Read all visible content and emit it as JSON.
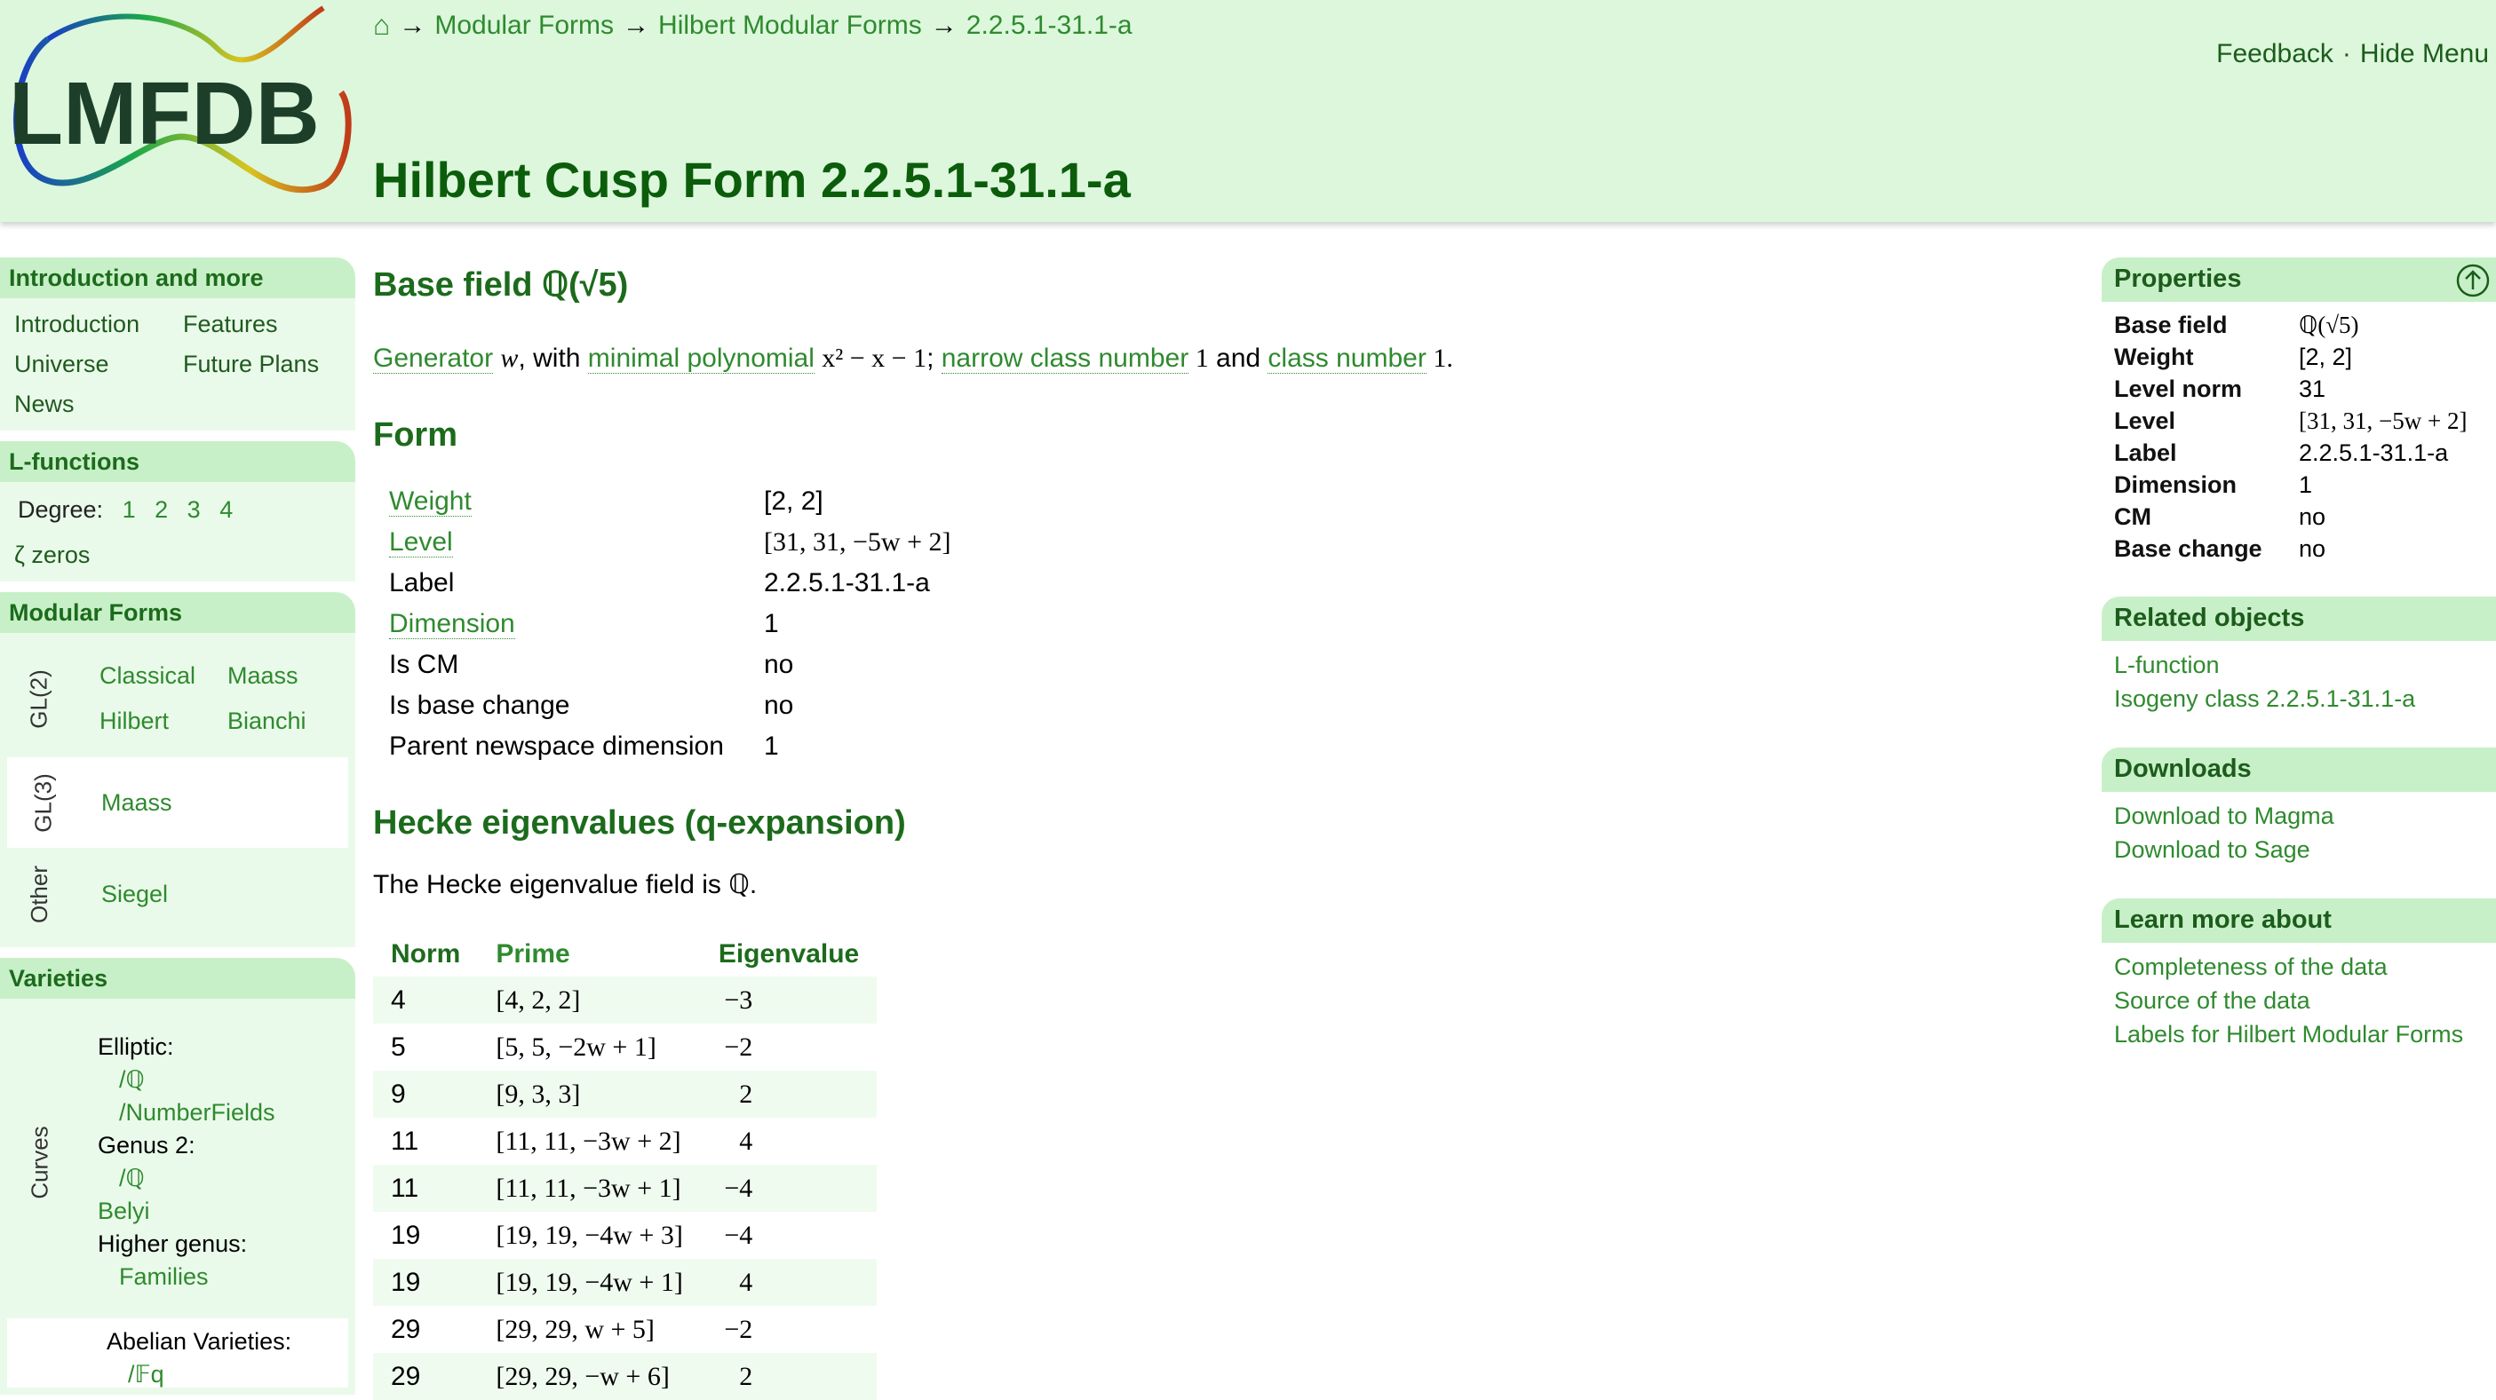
{
  "header": {
    "logo_text": "LMFDB",
    "breadcrumb": {
      "home_icon": "home-icon",
      "items": [
        "Modular Forms",
        "Hilbert Modular Forms",
        "2.2.5.1-31.1-a"
      ],
      "separator": "→"
    },
    "feedback": "Feedback",
    "dot": "·",
    "hide_menu": "Hide Menu",
    "title": "Hilbert Cusp Form 2.2.5.1-31.1-a"
  },
  "sidebar": {
    "intro": {
      "heading": "Introduction and more",
      "items": [
        "Introduction",
        "Features",
        "Universe",
        "Future Plans",
        "News"
      ]
    },
    "lfunctions": {
      "heading": "L-functions",
      "degree_label": "Degree:",
      "degrees": [
        "1",
        "2",
        "3",
        "4"
      ],
      "zeros": "ζ zeros"
    },
    "modular": {
      "heading": "Modular Forms",
      "gl2_label": "GL(2)",
      "gl2_items": [
        "Classical",
        "Maass",
        "Hilbert",
        "Bianchi"
      ],
      "gl3_label": "GL(3)",
      "gl3_items": [
        "Maass"
      ],
      "other_label": "Other",
      "other_items": [
        "Siegel"
      ]
    },
    "varieties": {
      "heading": "Varieties",
      "curves_label": "Curves",
      "elliptic": "Elliptic:",
      "elliptic_q": "/ℚ",
      "elliptic_nf": "/NumberFields",
      "genus2": "Genus 2:",
      "genus2_q": "/ℚ",
      "belyi": "Belyi",
      "higher": "Higher genus:",
      "families": "Families",
      "abelian": "Abelian Varieties:",
      "abelian_fq": "/𝔽q"
    }
  },
  "main": {
    "base_field_heading": "Base field ℚ(√5)",
    "generator": {
      "gen_link": "Generator",
      "w": "w",
      "with": ", with ",
      "minpoly_link": "minimal polynomial",
      "poly": "x² − x − 1",
      "semi": "; ",
      "narrow_link": "narrow class number",
      "one1": " 1",
      "and": " and ",
      "class_link": "class number",
      "one2": " 1."
    },
    "form_heading": "Form",
    "form_rows": [
      {
        "key": "Weight",
        "value": "[2, 2]"
      },
      {
        "key": "Level",
        "value": "[31, 31, −5w + 2]"
      },
      {
        "key": "Label",
        "value": "2.2.5.1-31.1-a"
      },
      {
        "key": "Dimension",
        "value": "1"
      },
      {
        "key": "Is CM",
        "value": "no"
      },
      {
        "key": "Is base change",
        "value": "no"
      },
      {
        "key": "Parent newspace dimension",
        "value": "1"
      }
    ],
    "hecke_heading": "Hecke eigenvalues (q-expansion)",
    "hecke_field_text": "The Hecke eigenvalue field is ℚ.",
    "eig_headers": [
      "Norm",
      "Prime",
      "Eigenvalue"
    ],
    "eig_rows": [
      {
        "norm": "4",
        "prime": "[4, 2, 2]",
        "ev": "−3"
      },
      {
        "norm": "5",
        "prime": "[5, 5, −2w + 1]",
        "ev": "−2"
      },
      {
        "norm": "9",
        "prime": "[9, 3, 3]",
        "ev": "2"
      },
      {
        "norm": "11",
        "prime": "[11, 11, −3w + 2]",
        "ev": "4"
      },
      {
        "norm": "11",
        "prime": "[11, 11, −3w + 1]",
        "ev": "−4"
      },
      {
        "norm": "19",
        "prime": "[19, 19, −4w + 3]",
        "ev": "−4"
      },
      {
        "norm": "19",
        "prime": "[19, 19, −4w + 1]",
        "ev": "4"
      },
      {
        "norm": "29",
        "prime": "[29, 29, w + 5]",
        "ev": "−2"
      },
      {
        "norm": "29",
        "prime": "[29, 29, −w + 6]",
        "ev": "2"
      }
    ]
  },
  "rightbar": {
    "properties": {
      "heading": "Properties",
      "rows": [
        {
          "key": "Base field",
          "value": "ℚ(√5)"
        },
        {
          "key": "Weight",
          "value": "[2, 2]"
        },
        {
          "key": "Level norm",
          "value": "31"
        },
        {
          "key": "Level",
          "value": "[31, 31, −5w + 2]"
        },
        {
          "key": "Label",
          "value": "2.2.5.1-31.1-a"
        },
        {
          "key": "Dimension",
          "value": "1"
        },
        {
          "key": "CM",
          "value": "no"
        },
        {
          "key": "Base change",
          "value": "no"
        }
      ]
    },
    "related": {
      "heading": "Related objects",
      "items": [
        "L-function",
        "Isogeny class 2.2.5.1-31.1-a"
      ]
    },
    "downloads": {
      "heading": "Downloads",
      "items": [
        "Download to Magma",
        "Download to Sage"
      ]
    },
    "learn": {
      "heading": "Learn more about",
      "items": [
        "Completeness of the data",
        "Source of the data",
        "Labels for Hilbert Modular Forms"
      ]
    }
  }
}
